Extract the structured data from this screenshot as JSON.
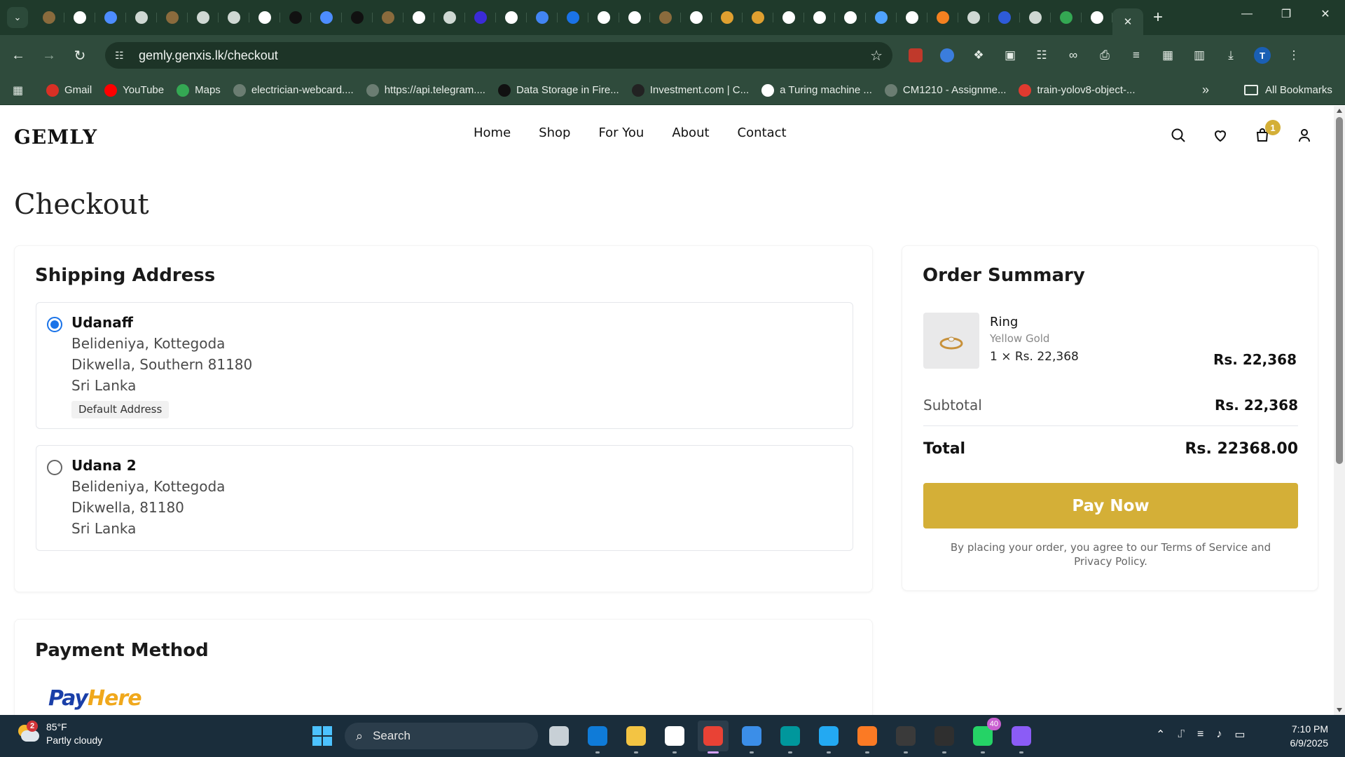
{
  "browser": {
    "tabs": [
      {
        "icon": "rabbit-icon",
        "color": "#8a6b3d"
      },
      {
        "icon": "openai-icon",
        "color": "#ffffff"
      },
      {
        "icon": "butterfly-icon",
        "color": "#4d8dff"
      },
      {
        "icon": "globe-icon",
        "color": "#cfd8d3"
      },
      {
        "icon": "rabbit-icon",
        "color": "#8a6b3d"
      },
      {
        "icon": "globe-icon",
        "color": "#cfd8d3"
      },
      {
        "icon": "globe-icon",
        "color": "#cfd8d3"
      },
      {
        "icon": "google-icon",
        "color": "#ffffff"
      },
      {
        "icon": "ai-studio-icon",
        "color": "#111111"
      },
      {
        "icon": "butterfly-icon",
        "color": "#4d8dff"
      },
      {
        "icon": "ai-studio-icon",
        "color": "#111111"
      },
      {
        "icon": "rabbit-icon",
        "color": "#8a6b3d"
      },
      {
        "icon": "google-icon",
        "color": "#ffffff"
      },
      {
        "icon": "globe-icon",
        "color": "#cfd8d3"
      },
      {
        "icon": "perplexity-icon",
        "color": "#3b2bd6"
      },
      {
        "icon": "openai-icon",
        "color": "#ffffff"
      },
      {
        "icon": "docs-icon",
        "color": "#4285f4"
      },
      {
        "icon": "c-icon",
        "color": "#1a73e8"
      },
      {
        "icon": "github-icon",
        "color": "#ffffff"
      },
      {
        "icon": "github-icon",
        "color": "#ffffff"
      },
      {
        "icon": "rabbit-icon",
        "color": "#8a6b3d"
      },
      {
        "icon": "openai-icon",
        "color": "#ffffff"
      },
      {
        "icon": "tent-icon",
        "color": "#e0a030"
      },
      {
        "icon": "tent-icon",
        "color": "#e0a030"
      },
      {
        "icon": "openai-icon",
        "color": "#ffffff"
      },
      {
        "icon": "github-icon",
        "color": "#ffffff"
      },
      {
        "icon": "github-icon",
        "color": "#ffffff"
      },
      {
        "icon": "cloud-icon",
        "color": "#4fa3ff"
      },
      {
        "icon": "openai-icon",
        "color": "#ffffff"
      },
      {
        "icon": "cloudflare-icon",
        "color": "#f48120"
      },
      {
        "icon": "globe-icon",
        "color": "#cfd8d3"
      },
      {
        "icon": "paypal-icon",
        "color": "#2e5bd8"
      },
      {
        "icon": "globe-icon",
        "color": "#cfd8d3"
      },
      {
        "icon": "drive-icon",
        "color": "#34a853"
      },
      {
        "icon": "openai-icon",
        "color": "#ffffff"
      }
    ],
    "url": "gemly.genxis.lk/checkout",
    "profile_initial": "T",
    "bookmarks": [
      {
        "label": "Gmail",
        "icon": "gmail-icon",
        "color": "#d93025"
      },
      {
        "label": "YouTube",
        "icon": "youtube-icon",
        "color": "#ff0000"
      },
      {
        "label": "Maps",
        "icon": "maps-icon",
        "color": "#34a853"
      },
      {
        "label": "electrician-webcard....",
        "icon": "globe-icon",
        "color": "#6b7d72"
      },
      {
        "label": "https://api.telegram....",
        "icon": "globe-icon",
        "color": "#6b7d72"
      },
      {
        "label": "Data Storage in Fire...",
        "icon": "github-icon",
        "color": "#111111"
      },
      {
        "label": "Investment.com | C...",
        "icon": "inv-icon",
        "color": "#222222"
      },
      {
        "label": "a Turing machine ...",
        "icon": "google-icon",
        "color": "#ffffff"
      },
      {
        "label": "CM1210 - Assignme...",
        "icon": "globe-icon",
        "color": "#6b7d72"
      },
      {
        "label": "train-yolov8-object-...",
        "icon": "roboflow-icon",
        "color": "#e03a2f"
      }
    ],
    "all_bookmarks": "All Bookmarks"
  },
  "site": {
    "logo": "GEMLY",
    "nav": [
      "Home",
      "Shop",
      "For You",
      "About",
      "Contact"
    ],
    "cart_count": "1",
    "accent": "#d4af37"
  },
  "checkout": {
    "title": "Checkout",
    "shipping": {
      "title": "Shipping Address",
      "addresses": [
        {
          "name": "Udanaff",
          "line1": "Belideniya, Kottegoda",
          "line2": "Dikwella, Southern 81180",
          "country": "Sri Lanka",
          "tag": "Default Address",
          "selected": true
        },
        {
          "name": "Udana 2",
          "line1": "Belideniya, Kottegoda",
          "line2": "Dikwella, 81180",
          "country": "Sri Lanka",
          "selected": false
        }
      ]
    },
    "summary": {
      "title": "Order Summary",
      "item": {
        "name": "Ring",
        "variant": "Yellow Gold",
        "qty_price": "1 × Rs. 22,368",
        "total": "Rs. 22,368"
      },
      "subtotal_label": "Subtotal",
      "subtotal_value": "Rs. 22,368",
      "total_label": "Total",
      "total_value": "Rs. 22368.00",
      "pay_button": "Pay Now",
      "terms": "By placing your order, you agree to our Terms of Service and Privacy Policy."
    },
    "payment": {
      "title": "Payment Method",
      "logo_pay": "Pay",
      "logo_here": "Here"
    }
  },
  "taskbar": {
    "weather_temp": "85°F",
    "weather_desc": "Partly cloudy",
    "weather_badge": "2",
    "search_placeholder": "Search",
    "apps": [
      {
        "icon": "task-view-icon",
        "color": "#c8d0d6"
      },
      {
        "icon": "edge-icon",
        "color": "#0f7bd8"
      },
      {
        "icon": "file-explorer-icon",
        "color": "#f3c443"
      },
      {
        "icon": "ms-store-icon",
        "color": "#ffffff"
      },
      {
        "icon": "chrome-icon",
        "color": "#e94235",
        "active": true
      },
      {
        "icon": "notepad-icon",
        "color": "#3b8ee8"
      },
      {
        "icon": "arduino-icon",
        "color": "#00979c"
      },
      {
        "icon": "vscode-icon",
        "color": "#23a9f2"
      },
      {
        "icon": "xampp-icon",
        "color": "#fb7a24"
      },
      {
        "icon": "obs-icon",
        "color": "#3a3a3a"
      },
      {
        "icon": "terminal-icon",
        "color": "#2f2f2f"
      },
      {
        "icon": "whatsapp-icon",
        "color": "#25d366",
        "badge": "40"
      },
      {
        "icon": "obsidian-icon",
        "color": "#8b5cf6"
      }
    ],
    "time": "7:10 PM",
    "date": "6/9/2025"
  }
}
